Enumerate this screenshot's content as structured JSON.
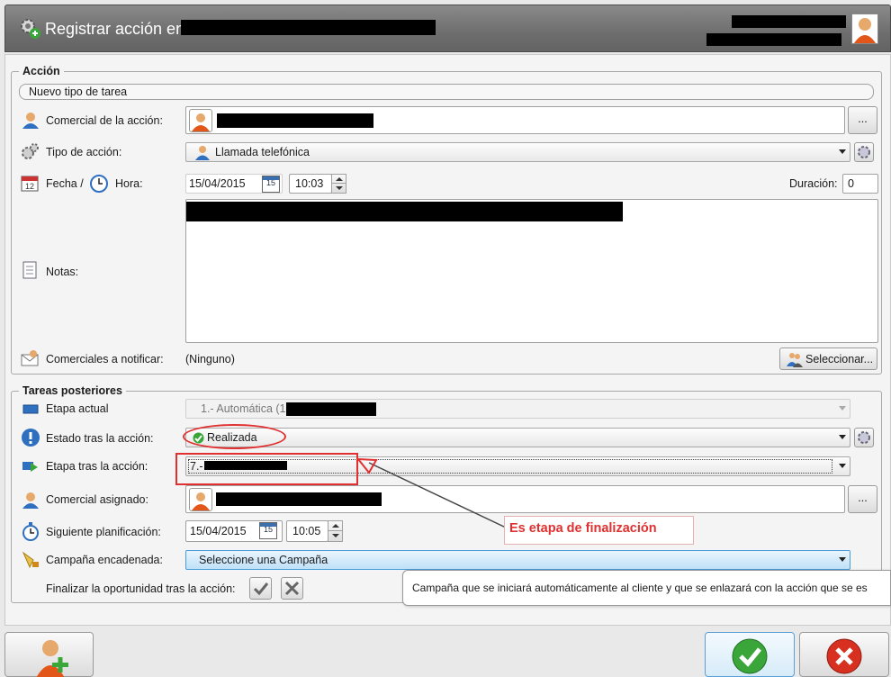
{
  "window": {
    "title": "Registrar acción en"
  },
  "accion": {
    "legend": "Acción",
    "task_type_placeholder": "Nuevo tipo de tarea",
    "comercial_label": "Comercial de la acción:",
    "browse_label": "...",
    "tipo_label": "Tipo de acción:",
    "tipo_value": "Llamada telefónica",
    "fecha_label": "Fecha /",
    "hora_label": "Hora:",
    "fecha_value": "15/04/2015",
    "hora_value": "10:03",
    "cal_day": "15",
    "duracion_label": "Duración:",
    "duracion_value": "0",
    "notas_label": "Notas:",
    "notificar_label": "Comerciales a notificar:",
    "notificar_value": "(Ninguno)",
    "seleccionar_label": "Seleccionar..."
  },
  "tareas": {
    "legend": "Tareas posteriores",
    "etapa_actual_label": "Etapa actual",
    "etapa_actual_value": "1.- Automática (1.-",
    "estado_label": "Estado tras la acción:",
    "estado_value": "Realizada",
    "etapa_tras_label": "Etapa tras la acción:",
    "etapa_tras_value": "7.-",
    "comercial_asignado_label": "Comercial asignado:",
    "browse_label": "...",
    "siguiente_label": "Siguiente planificación:",
    "siguiente_fecha": "15/04/2015",
    "siguiente_hora": "10:05",
    "cal_day": "15",
    "campana_label": "Campaña encadenada:",
    "campana_value": "Seleccione una Campaña",
    "finalizar_label": "Finalizar la oportunidad tras la acción:"
  },
  "annotation": {
    "text": "Es etapa de finalización",
    "color": "#e03030"
  },
  "tooltip": {
    "text": "Campaña que se iniciará automáticamente al cliente y que se enlazará con la acción que se es"
  },
  "colors": {
    "accent_blue": "#2f6fbf",
    "ok_green": "#3aa63a",
    "cancel_red": "#d83020"
  }
}
